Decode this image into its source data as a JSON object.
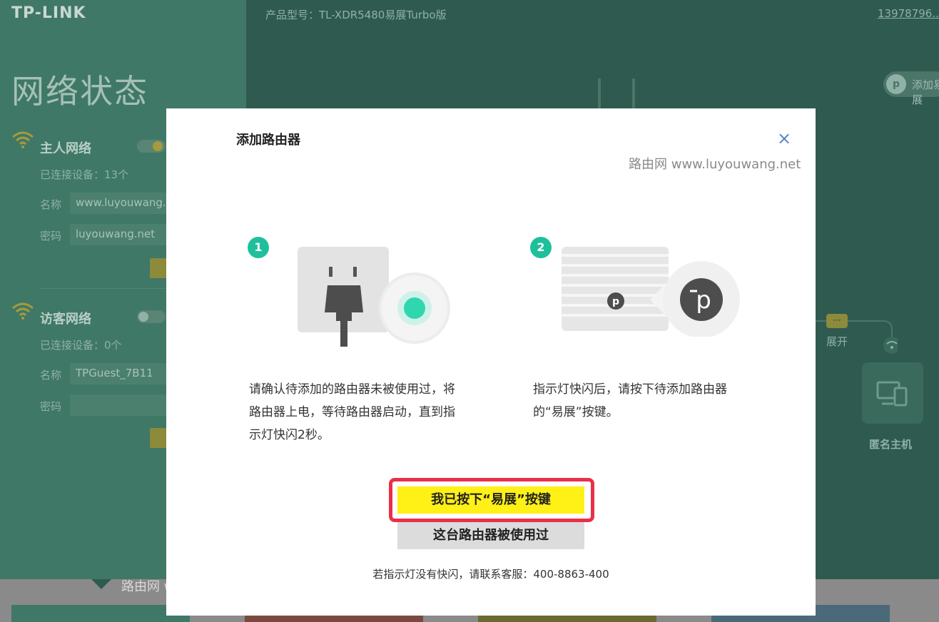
{
  "header": {
    "brand": "TP-LINK",
    "model": "产品型号：TL-XDR5480易展Turbo版",
    "account": "13978796..."
  },
  "sidebar": {
    "title": "网络状态",
    "host_network": {
      "title": "主人网络",
      "devices": "已连接设备：13个",
      "name_label": "名称",
      "name_value": "www.luyouwang.net",
      "password_label": "密码",
      "password_value": "luyouwang.net"
    },
    "guest_network": {
      "title": "访客网络",
      "devices": "已连接设备：0个",
      "name_label": "名称",
      "name_value": "TPGuest_7B11",
      "password_label": "密码",
      "password_value": ""
    }
  },
  "topology": {
    "add_label": "添加易展",
    "expand_dots": "···",
    "expand_label": "展开",
    "anon_host_label": "匿名主机"
  },
  "watermarks": {
    "top": "路由网 www.luyouwang.net",
    "bottom": "路由网 www.luyouwang.net"
  },
  "modal": {
    "title": "添加路由器",
    "close": "×",
    "steps": [
      {
        "number": "1",
        "text": "请确认待添加的路由器未被使用过，将路由器上电，等待路由器启动，直到指示灯快闪2秒。"
      },
      {
        "number": "2",
        "text": "指示灯快闪后，请按下待添加路由器的“易展”按键。"
      }
    ],
    "primary_button": "我已按下“易展”按键",
    "secondary_button": "这台路由器被使用过",
    "support_text": "若指示灯没有快闪，请联系客服：400-8863-400",
    "router_logo": "p"
  },
  "colors": {
    "accent_teal": "#1fbf9c",
    "primary_yellow": "#fff016",
    "highlight_red": "#e8304a",
    "close_blue": "#4f86c6"
  }
}
